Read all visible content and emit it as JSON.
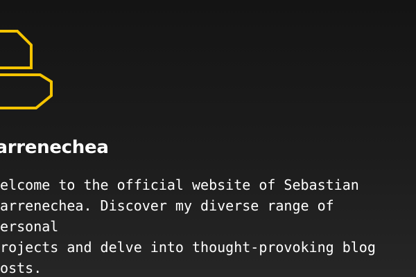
{
  "site": {
    "title": "Barrenechea",
    "intro": "Welcome to the official website of Sebastian\nBarrenechea. Discover my diverse range of personal\nprojects and delve into thought-provoking blog\nposts.",
    "accent_color": "#f5c400",
    "logo_icon": "stacked-hexagon-logo-icon"
  }
}
